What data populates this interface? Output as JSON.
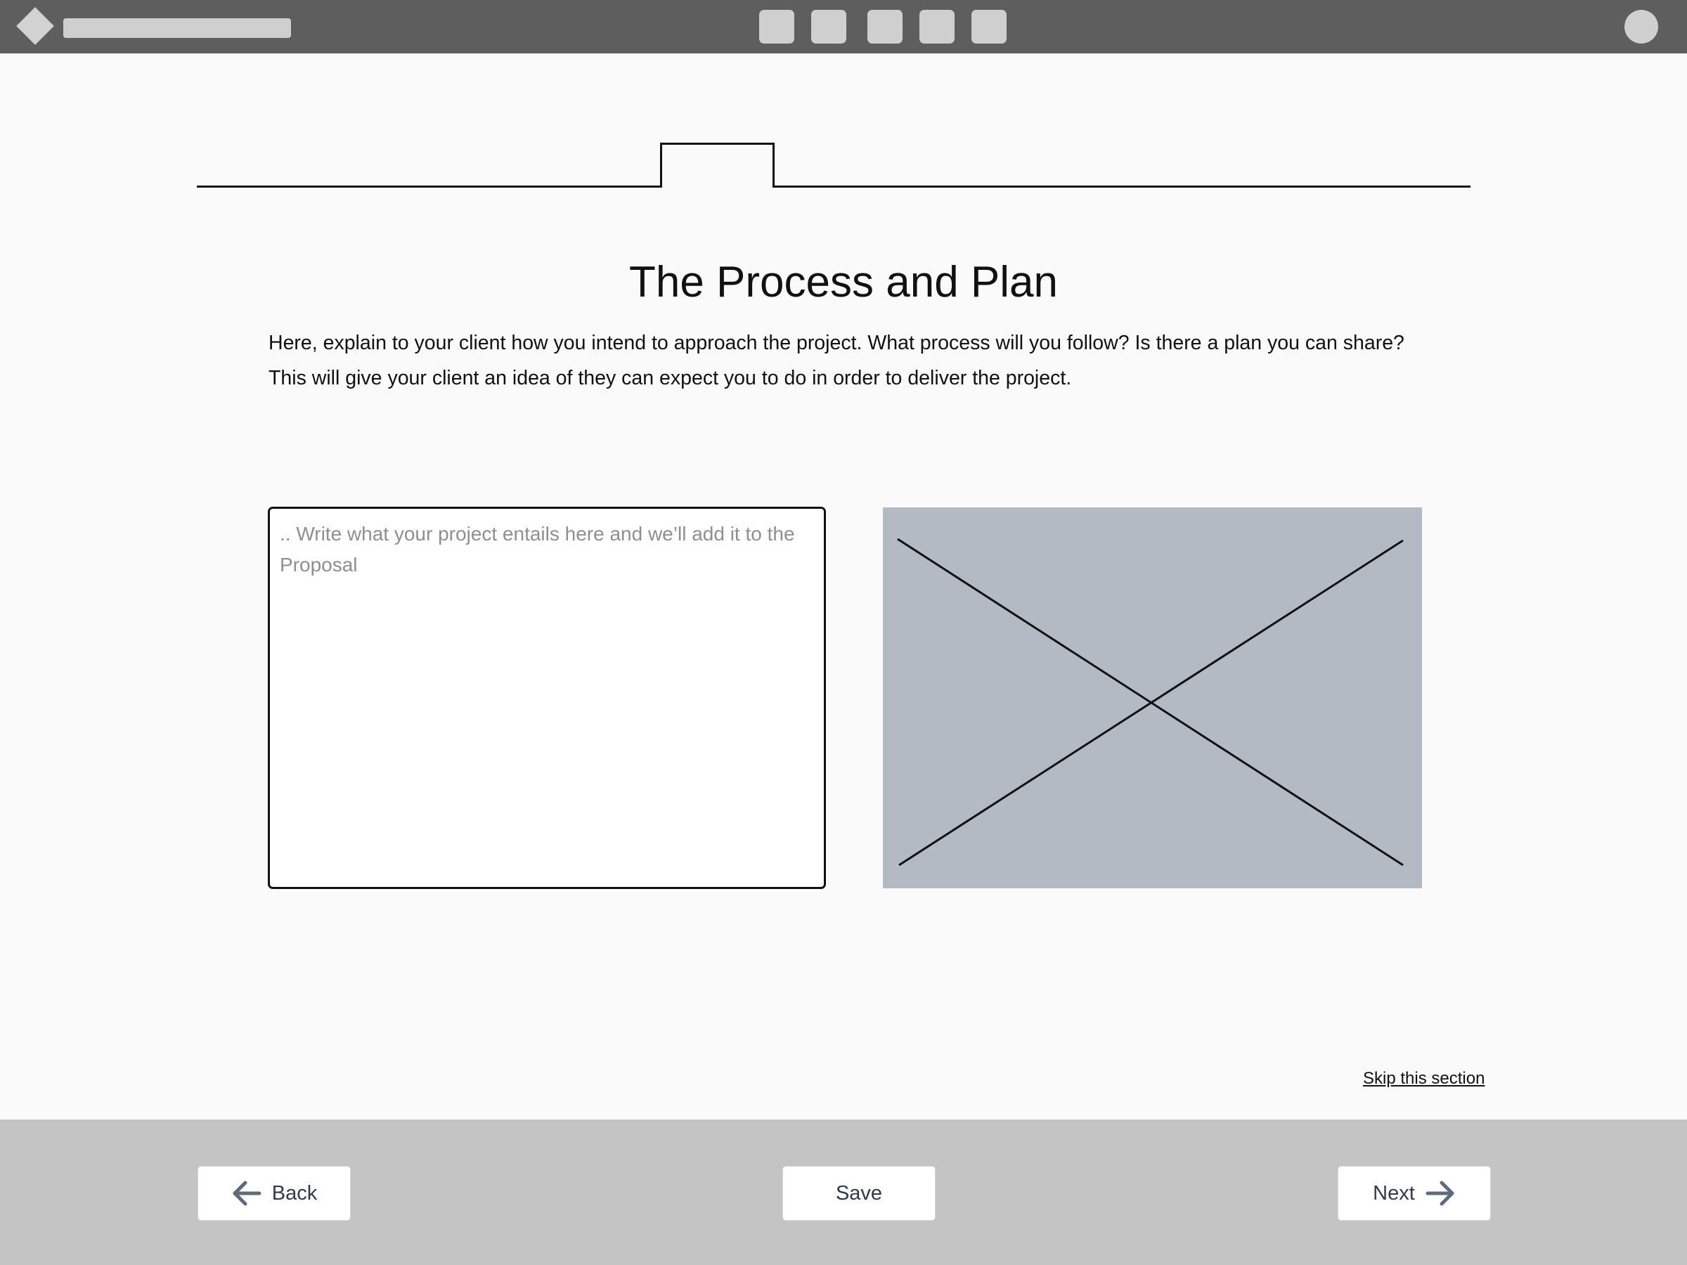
{
  "header": {
    "logo_icon": "diamond-logo-icon",
    "nav_buttons": [
      "nav-button",
      "nav-button",
      "nav-button",
      "nav-button",
      "nav-button"
    ],
    "avatar_icon": "user-avatar-icon"
  },
  "content": {
    "title": "The Process and Plan",
    "description": "Here, explain to your client how you intend to approach the project. What process will you follow? Is there a plan you can share? This will give your client an idea of they can expect you to do in order to deliver the project.",
    "textarea": {
      "placeholder": ".. Write what your project entails here and we’ll add it to the Proposal",
      "value": ""
    },
    "image_icon": "image-placeholder-icon",
    "skip_label": "Skip this section"
  },
  "footer": {
    "back_label": "Back",
    "save_label": "Save",
    "next_label": "Next",
    "back_icon": "arrow-left-icon",
    "next_icon": "arrow-right-icon"
  },
  "colors": {
    "topbar": "#5e5e5e",
    "footer": "#c4c4c4",
    "image_placeholder": "#b3bac4",
    "button_text": "#2f3a4a"
  }
}
